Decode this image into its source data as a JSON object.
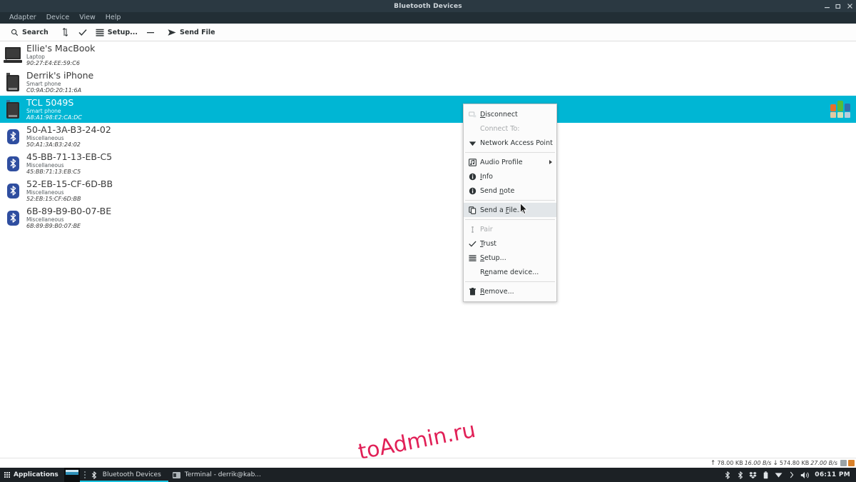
{
  "window": {
    "title": "Bluetooth Devices",
    "controls": [
      {
        "name": "minimize",
        "glyph": "minimize-icon"
      },
      {
        "name": "maximize",
        "glyph": "maximize-icon"
      },
      {
        "name": "close",
        "glyph": "close-icon"
      }
    ]
  },
  "menubar": {
    "items": [
      {
        "label": "Adapter"
      },
      {
        "label": "Device"
      },
      {
        "label": "View"
      },
      {
        "label": "Help"
      }
    ]
  },
  "toolbar": {
    "items": [
      {
        "label": "Search",
        "icon": "search-icon",
        "has_label": true
      },
      {
        "label": "",
        "icon": "transfer-icon",
        "has_label": false
      },
      {
        "label": "",
        "icon": "check-icon",
        "has_label": false
      },
      {
        "label": "Setup...",
        "icon": "list-icon",
        "has_label": true
      },
      {
        "label": "",
        "icon": "minus-icon",
        "has_label": false
      },
      {
        "label": "Send File",
        "icon": "send-icon",
        "has_label": true
      }
    ]
  },
  "devices": [
    {
      "name": "Ellie's MacBook",
      "type": "Laptop",
      "mac": "90:27:E4:EE:59:C6",
      "icon": "laptop-icon",
      "selected": false,
      "trusted": true
    },
    {
      "name": "Derrik's iPhone",
      "type": "Smart phone",
      "mac": "C0:9A:D0:20:11:6A",
      "icon": "phone-icon",
      "selected": false,
      "trusted": false
    },
    {
      "name": "TCL 5049S",
      "type": "Smart phone",
      "mac": "A8:A1:98:E2:CA:DC",
      "icon": "phone-icon",
      "selected": true,
      "trusted": false
    },
    {
      "name": "50-A1-3A-B3-24-02",
      "type": "Miscellaneous",
      "mac": "50:A1:3A:B3:24:02",
      "icon": "bluetooth-icon",
      "selected": false,
      "trusted": false
    },
    {
      "name": "45-BB-71-13-EB-C5",
      "type": "Miscellaneous",
      "mac": "45:BB:71:13:EB:C5",
      "icon": "bluetooth-icon",
      "selected": false,
      "trusted": false
    },
    {
      "name": "52-EB-15-CF-6D-BB",
      "type": "Miscellaneous",
      "mac": "52:EB:15:CF:6D:BB",
      "icon": "bluetooth-icon",
      "selected": false,
      "trusted": false
    },
    {
      "name": "6B-89-B9-B0-07-BE",
      "type": "Miscellaneous",
      "mac": "6B:89:B9:B0:07:BE",
      "icon": "bluetooth-icon",
      "selected": false,
      "trusted": false
    }
  ],
  "context_menu": {
    "items": [
      {
        "label": "Disconnect",
        "mnemonic": "D",
        "icon": "disconnect-icon",
        "state": "normal",
        "kind": "item"
      },
      {
        "label": "Connect To:",
        "mnemonic": "",
        "icon": "none",
        "state": "disabled",
        "kind": "header"
      },
      {
        "label": "Network Access Point",
        "mnemonic": "",
        "icon": "network-icon",
        "state": "normal",
        "kind": "item"
      },
      {
        "kind": "separator"
      },
      {
        "label": "Audio Profile",
        "mnemonic": "",
        "icon": "audio-icon",
        "state": "normal",
        "kind": "submenu"
      },
      {
        "label": "Info",
        "mnemonic": "I",
        "icon": "info-icon",
        "state": "normal",
        "kind": "item"
      },
      {
        "label": "Send note",
        "mnemonic": "n",
        "icon": "info-icon",
        "state": "normal",
        "kind": "item"
      },
      {
        "kind": "separator"
      },
      {
        "label": "Send a File...",
        "mnemonic": "F",
        "icon": "copy-icon",
        "state": "highlighted",
        "kind": "item"
      },
      {
        "kind": "separator"
      },
      {
        "label": "Pair",
        "mnemonic": "",
        "icon": "pair-icon",
        "state": "disabled",
        "kind": "item"
      },
      {
        "label": "Trust",
        "mnemonic": "T",
        "icon": "check-icon",
        "state": "normal",
        "kind": "item"
      },
      {
        "label": "Setup...",
        "mnemonic": "S",
        "icon": "list-icon",
        "state": "normal",
        "kind": "item"
      },
      {
        "label": "Rename device...",
        "mnemonic": "e",
        "icon": "none",
        "state": "normal",
        "kind": "item"
      },
      {
        "kind": "separator"
      },
      {
        "label": "Remove...",
        "mnemonic": "R",
        "icon": "trash-icon",
        "state": "normal",
        "kind": "item"
      }
    ]
  },
  "watermark": {
    "text": "toAdmin.ru",
    "color": "#e0154f"
  },
  "net_stats": {
    "up_total": "78.00 KB",
    "up_rate": "16.00 B/s",
    "down_total": "574.80 KB",
    "down_rate": "27.00 B/s",
    "up_arrow": "↑",
    "down_arrow": "↓"
  },
  "taskbar": {
    "applications_label": "Applications",
    "tasks": [
      {
        "label": "Bluetooth Devices",
        "icon": "bluetooth-icon",
        "active": true
      },
      {
        "label": "Terminal - derrik@kab...",
        "icon": "terminal-icon",
        "active": false
      }
    ],
    "tray_icons": [
      "bluetooth-icon",
      "bluetooth-icon",
      "dropbox-icon",
      "battery-icon",
      "network-icon",
      "chevron-right-icon",
      "volume-icon"
    ],
    "clock": "06:11 PM"
  },
  "colors": {
    "selection": "#00b6d4",
    "titlebar": "#2b3942",
    "menubar": "#222e35",
    "taskbar": "#1c2125",
    "accent_underline": "#19c3e0"
  }
}
